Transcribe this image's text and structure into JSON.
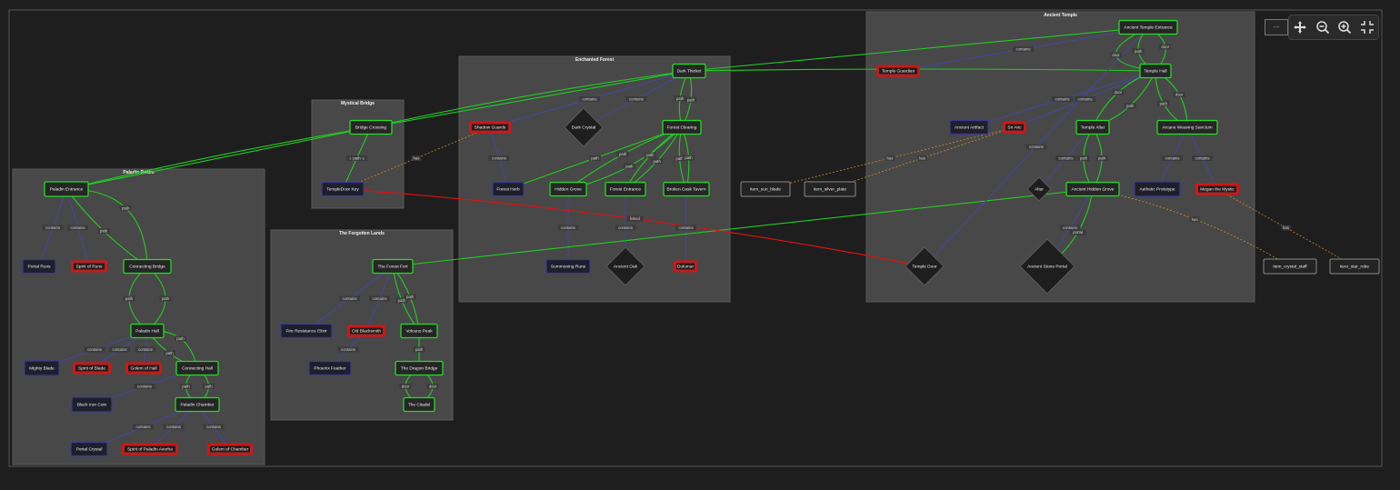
{
  "groups": {
    "paladin": "Paladin Realm",
    "mystical": "Mystical Bridge",
    "forgotten": "The Forgotten Lands",
    "enchanted": "Enchanted Forest",
    "ancient": "Ancient Temple"
  },
  "nodes": {
    "paladin_entrance": "Paladin Entrance",
    "portal_runs": "Portal Runs",
    "spirit_of_runs": "Spirit of Runs",
    "connecting_bridge": "Connecting Bridge",
    "paladin_hall": "Paladin Hall",
    "mighty_blade": "Mighty Blade",
    "spirit_of_blade": "Spirit of Blade",
    "golem_of_hall": "Golem of Hall",
    "connecting_hall": "Connecting Hall",
    "black_iron_coin": "Black Iron Coin",
    "paladin_chamber": "Paladin Chamber",
    "portal_crystal": "Portal Crystal",
    "spirit_paladin_avorha": "Spirit of Paladin Avorha",
    "golem_of_chamber": "Golem of Chamber",
    "bridge_crossing": "Bridge Crossing",
    "temple_door_key": "TempleDoor Key",
    "forest_fort": "The Forest Fort",
    "fire_resistance_elixir": "Fire Resistance Elixir",
    "old_blacksmith": "Old Blacksmith",
    "volcano_peak": "Volcano Peak",
    "phoenix_feather": "Phoenix Feather",
    "dragon_bridge": "The Dragon Bridge",
    "the_citadel": "The Citadel",
    "dark_thicket": "Dark Thicket",
    "shadow_guards": "Shadow Guards",
    "dark_crystal": "Dark Crystal",
    "forest_clearing": "Forest Clearing",
    "forest_herb": "Forest Herb",
    "hidden_grove": "Hidden Grove",
    "forest_entrance": "Forest Entrance",
    "broken_cask_tavern": "Broken Cask Tavern",
    "summoning_runs": "Summoning Runs",
    "ancient_oak": "Ancient Oak",
    "dulumar": "Dulumar",
    "item_sun_blade": "item_sun_blade",
    "item_silver_plate": "item_silver_plate",
    "ancient_temple_entrance": "Ancient Temple Entrance",
    "temple_guardian": "Temple Guardian",
    "temple_hall": "Temple Hall",
    "ancient_artifact": "Ancient Artifact",
    "sir_aric": "Sir Aric",
    "temple_altar": "Temple Altar",
    "arcane_weaving_sanctum": "Arcane Weaving Sanctum",
    "altar": "Altar",
    "ancient_hidden_grove": "Ancient Hidden Grove",
    "aethetic_prototype": "Aethetic Prototype",
    "megan_the_mystic": "Megan the Mystic",
    "temple_door": "Temple Door",
    "ancient_stone_portal": "Ancient Stone Portal",
    "item_crystal_staff": "item_crystal_staff",
    "item_star_robe": "item_star_robe"
  },
  "edge_labels": {
    "contains": "contains",
    "path": "path",
    "has": "has",
    "door": "door",
    "leads_to": "leads_to",
    "linked": "linked",
    "portal": "portal"
  },
  "toolbar": {
    "pan": "pan-icon",
    "zoom_out": "zoom-out-icon",
    "zoom_in": "zoom-in-icon",
    "fit": "fit-screen-icon",
    "minimap_label": "---"
  },
  "colors": {
    "background": "#1e1e1e",
    "group_fill": "#484848",
    "location_border": "#22dd22",
    "npc_border": "#e01010",
    "item_border": "#3a3a90",
    "path_edge": "#22cc22",
    "contains_edge": "#4444bb",
    "has_edge": "#c98a2a",
    "key_edge": "#dd1111",
    "external_border": "#888888"
  }
}
